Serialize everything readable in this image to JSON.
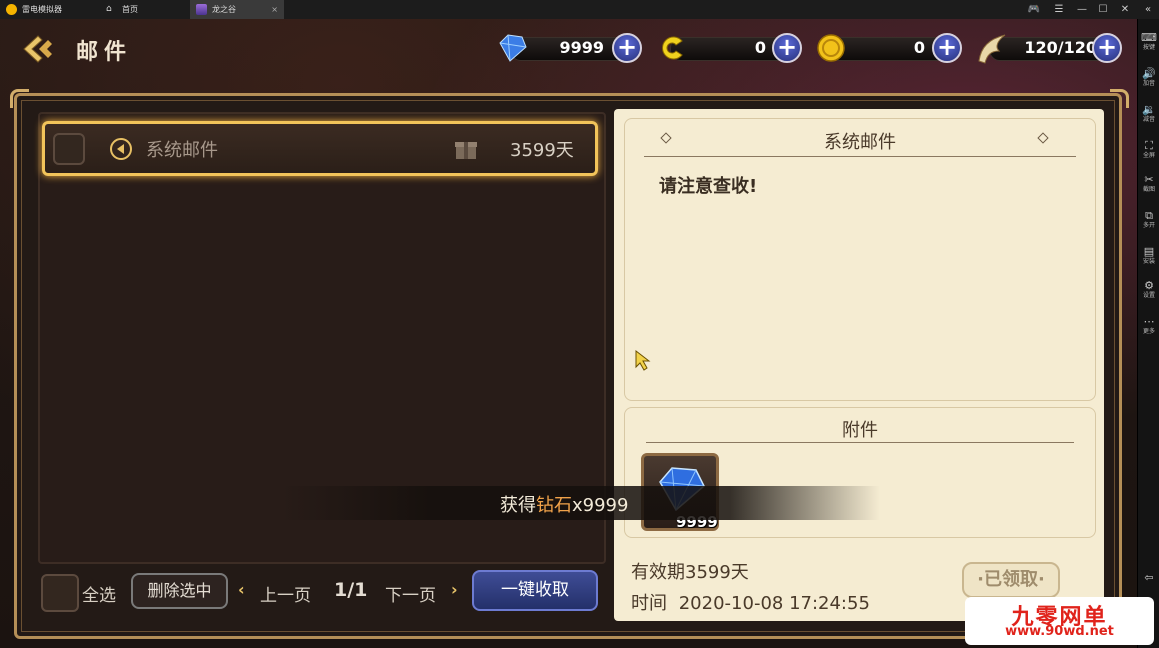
{
  "emulator": {
    "app_tab": "雷电模拟器",
    "home_tab": "首页",
    "game_tab": "龙之谷",
    "tab_close": "×",
    "sidebar": [
      {
        "icon": "keyboard-icon",
        "glyph": "⌨",
        "label": "按键"
      },
      {
        "icon": "volume-up-icon",
        "glyph": "🔊",
        "label": "加音"
      },
      {
        "icon": "volume-down-icon",
        "glyph": "🔉",
        "label": "减音"
      },
      {
        "icon": "fullscreen-icon",
        "glyph": "⛶",
        "label": "全屏"
      },
      {
        "icon": "scissors-icon",
        "glyph": "✂",
        "label": "截图"
      },
      {
        "icon": "multi-window-icon",
        "glyph": "⧉",
        "label": "多开"
      },
      {
        "icon": "install-apk-icon",
        "glyph": "▤",
        "label": "安装"
      },
      {
        "icon": "settings-icon",
        "glyph": "⚙",
        "label": "设置"
      },
      {
        "icon": "more-icon",
        "glyph": "⋯",
        "label": "更多"
      }
    ]
  },
  "header": {
    "title": "邮件",
    "resources": {
      "diamonds": "9999",
      "tokens": "0",
      "gold": "0",
      "stamina": "120/120"
    },
    "plus_glyph": "+"
  },
  "mail_list": {
    "items": [
      {
        "sender": "系统邮件",
        "days_left": "3599天"
      }
    ],
    "select_all_label": "全选",
    "delete_selected_label": "删除选中",
    "prev_page_label": "上一页",
    "next_page_label": "下一页",
    "page_indicator": "1/1",
    "collect_all_label": "一键收取"
  },
  "mail_detail": {
    "title": "系统邮件",
    "body": "请注意查收!",
    "attachments_title": "附件",
    "attachment_qty": "9999",
    "validity": "有效期3599天",
    "time_label": "时间",
    "time_value": "2020-10-08 17:24:55",
    "claimed_label": "·已领取·"
  },
  "toast": {
    "prefix": "获得",
    "item": "钻石",
    "suffix": "x9999"
  },
  "watermark": {
    "title": "九零网单",
    "url": "www.90wd.net"
  },
  "colors": {
    "highlight_border": "#f2c45a",
    "collect_button": "#3f4d96",
    "toast_item": "#f0a24a",
    "watermark_red": "#e0231b"
  }
}
